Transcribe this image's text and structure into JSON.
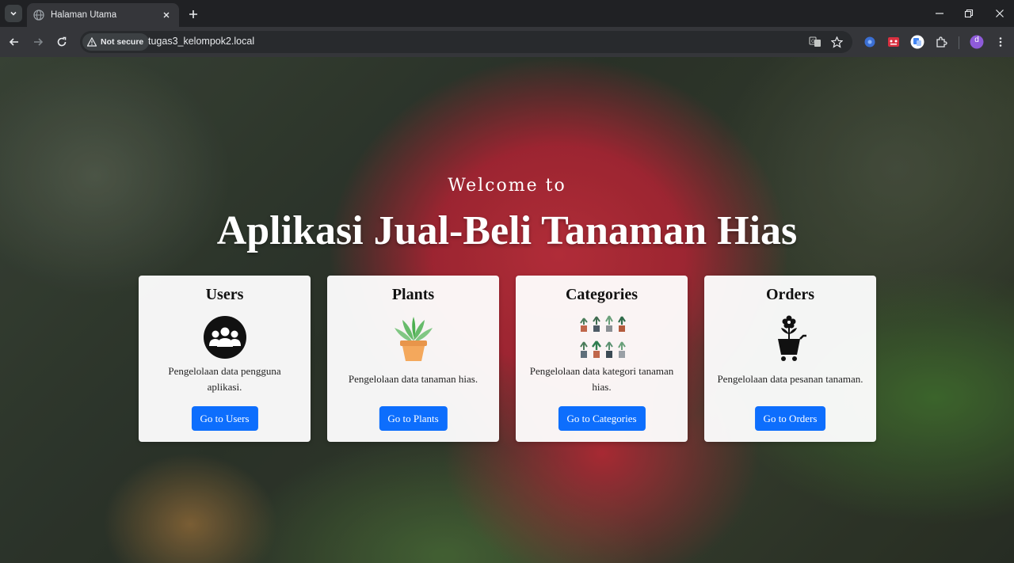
{
  "browser": {
    "tab": {
      "title": "Halaman Utama"
    },
    "omnibox": {
      "security_label": "Not secure",
      "url": "tugas3_kelompok2.local"
    },
    "profile_initial": "d",
    "colors": {
      "tabbar": "#202124",
      "toolbar": "#35363a",
      "omnibox": "#282a2d",
      "profile": "#8e5bd9"
    }
  },
  "hero": {
    "welcome": "Welcome to",
    "title": "Aplikasi Jual-Beli Tanaman Hias"
  },
  "cards": [
    {
      "title": "Users",
      "icon": "users-group-icon",
      "description": "Pengelolaan data pengguna aplikasi.",
      "button": "Go to Users"
    },
    {
      "title": "Plants",
      "icon": "potted-plant-icon",
      "description": "Pengelolaan data tanaman hias.",
      "button": "Go to Plants"
    },
    {
      "title": "Categories",
      "icon": "plant-categories-icon",
      "description": "Pengelolaan data kategori tanaman hias.",
      "button": "Go to Categories"
    },
    {
      "title": "Orders",
      "icon": "flower-cart-icon",
      "description": "Pengelolaan data pesanan tanaman.",
      "button": "Go to Orders"
    }
  ],
  "colors": {
    "button": "#0d6efd",
    "card": "#ffffff",
    "hero_text": "#ffffff"
  }
}
